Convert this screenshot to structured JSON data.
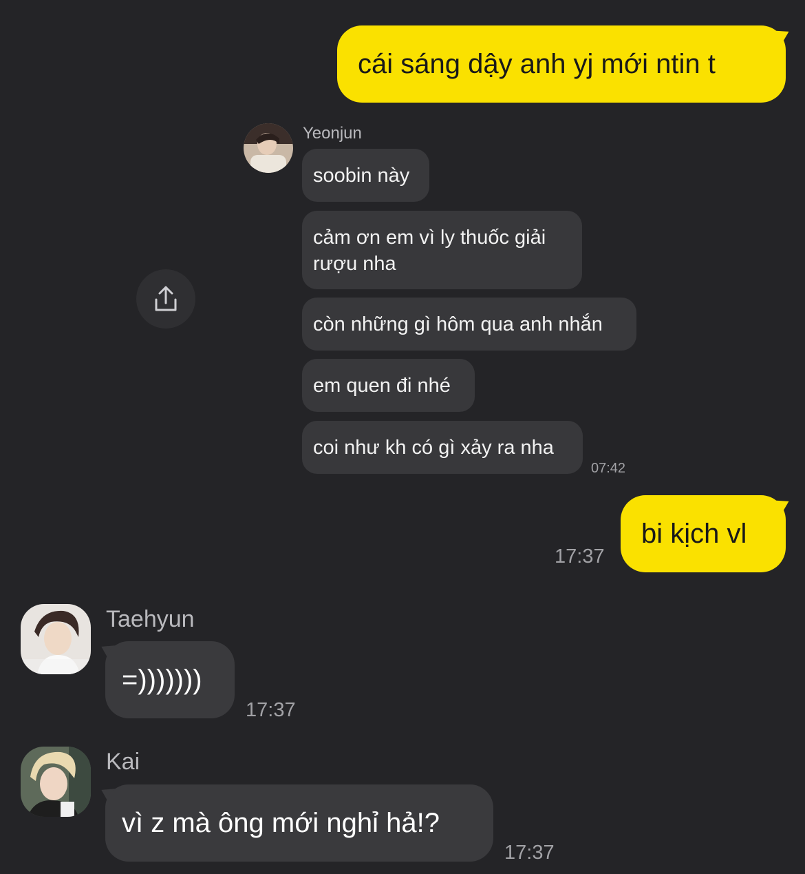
{
  "messages": {
    "me_1": {
      "text": "cái sáng dậy anh yj mới ntin t"
    },
    "forwarded": {
      "sender": "Yeonjun",
      "lines": [
        "soobin này",
        "cảm ơn em vì ly thuốc giải rượu nha",
        "còn những gì hôm qua anh nhắn",
        "em quen đi nhé",
        "coi như kh có gì xảy ra nha"
      ],
      "time": "07:42",
      "share_icon": "share-icon"
    },
    "me_2": {
      "text": "bi kịch vl",
      "time": "17:37"
    },
    "taehyun": {
      "sender": "Taehyun",
      "text": "=)))))))",
      "time": "17:37"
    },
    "kai": {
      "sender": "Kai",
      "text": "vì z mà ông mới nghỉ hả!?",
      "time": "17:37"
    }
  },
  "colors": {
    "background": "#242427",
    "my_bubble": "#fae100",
    "other_bubble": "#3a3a3d"
  }
}
